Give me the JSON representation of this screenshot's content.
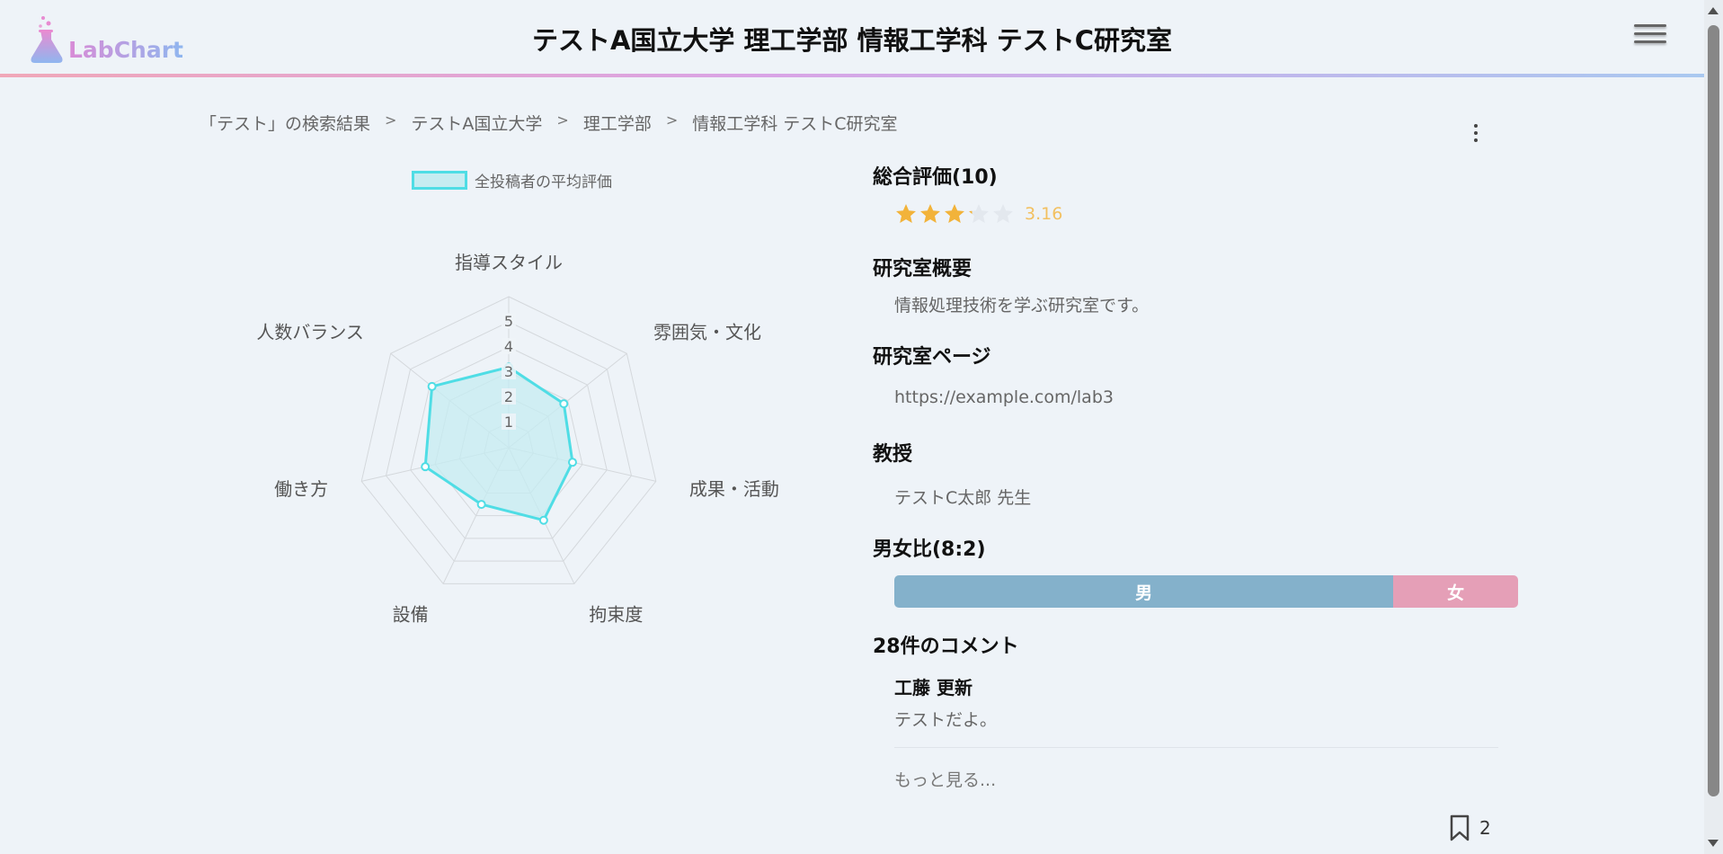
{
  "header": {
    "logo_text": "LabChart",
    "title": "テストA国立大学 理工学部 情報工学科 テストC研究室"
  },
  "breadcrumb": [
    "「テスト」の検索結果",
    "テストA国立大学",
    "理工学部",
    "情報工学科 テストC研究室"
  ],
  "breadcrumb_separator": ">",
  "chart_data": {
    "type": "radar",
    "legend": "全投稿者の平均評価",
    "axes": [
      "指導スタイル",
      "雰囲気・文化",
      "成果・活動",
      "拘束度",
      "設備",
      "働き方",
      "人数バランス"
    ],
    "values": [
      3.2,
      2.8,
      2.6,
      3.2,
      2.5,
      3.4,
      3.9
    ],
    "range": [
      0,
      5
    ],
    "ticks": [
      "1",
      "2",
      "3",
      "4",
      "5"
    ],
    "colors": {
      "line": "#4fdde5",
      "fill": "#c6ecf1",
      "grid": "#d4d8dc"
    }
  },
  "overall": {
    "title": "総合評価(10)",
    "rating": 3.16,
    "rating_label": "3.16",
    "max_stars": 5,
    "star_color": "#f2b33a"
  },
  "overview": {
    "title": "研究室概要",
    "text": "情報処理技術を学ぶ研究室です。"
  },
  "lab_page": {
    "title": "研究室ページ",
    "url": "https://example.com/lab3"
  },
  "professor": {
    "title": "教授",
    "name": "テストC太郎 先生"
  },
  "gender": {
    "title": "男女比(8:2)",
    "male_label": "男",
    "female_label": "女",
    "male_ratio": 0.8,
    "female_ratio": 0.2,
    "male_color": "#84b1cb",
    "female_color": "#e59fb7"
  },
  "comments": {
    "title": "28件のコメント",
    "items": [
      {
        "author": "工藤 更新",
        "text": "テストだよ。"
      }
    ],
    "more_label": "もっと見る..."
  },
  "bookmark": {
    "count": "2"
  }
}
